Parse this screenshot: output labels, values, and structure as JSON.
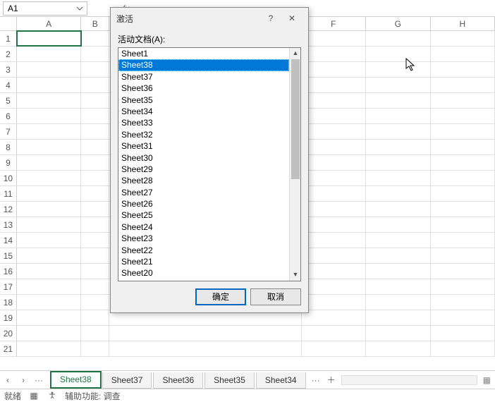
{
  "namebox": {
    "value": "A1"
  },
  "columns": [
    "A",
    "B",
    "F",
    "G",
    "H"
  ],
  "rows": [
    1,
    2,
    3,
    4,
    5,
    6,
    7,
    8,
    9,
    10,
    11,
    12,
    13,
    14,
    15,
    16,
    17,
    18,
    19,
    20,
    21
  ],
  "dialog": {
    "title": "激活",
    "label": "活动文档(A):",
    "items": [
      "Sheet1",
      "Sheet38",
      "Sheet37",
      "Sheet36",
      "Sheet35",
      "Sheet34",
      "Sheet33",
      "Sheet32",
      "Sheet31",
      "Sheet30",
      "Sheet29",
      "Sheet28",
      "Sheet27",
      "Sheet26",
      "Sheet25",
      "Sheet24",
      "Sheet23",
      "Sheet22",
      "Sheet21",
      "Sheet20"
    ],
    "selected_index": 1,
    "ok": "确定",
    "cancel": "取消",
    "help": "?",
    "close": "✕"
  },
  "tabs": {
    "items": [
      "Sheet38",
      "Sheet37",
      "Sheet36",
      "Sheet35",
      "Sheet34"
    ],
    "active_index": 0,
    "more": "···",
    "add": "＋"
  },
  "nav": {
    "prev": "‹",
    "next": "›",
    "menu": "···"
  },
  "status": {
    "ready": "就绪",
    "acc": "辅助功能: 调查"
  }
}
